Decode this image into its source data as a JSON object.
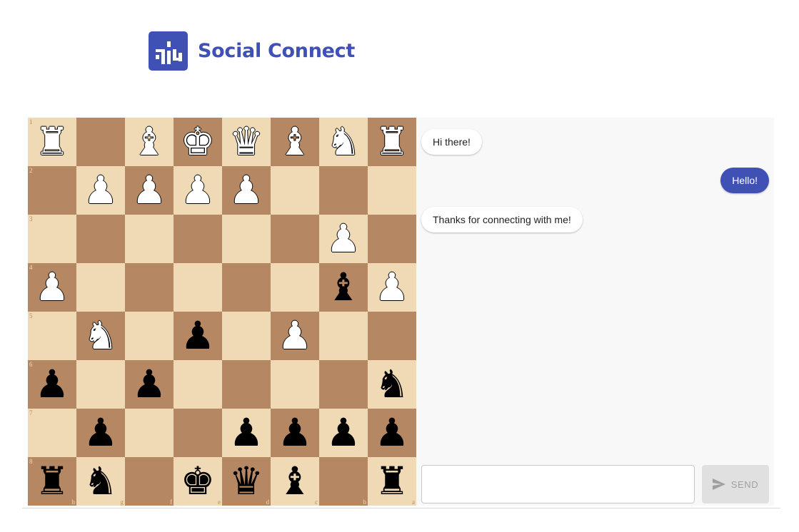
{
  "app": {
    "title": "Social Connect",
    "brand_color": "#3f51b5"
  },
  "board": {
    "light_color": "#f0d9b5",
    "dark_color": "#b58863",
    "rank_labels": [
      "1",
      "2",
      "3",
      "4",
      "5",
      "6",
      "7",
      "8"
    ],
    "file_labels": [
      "h",
      "g",
      "f",
      "e",
      "d",
      "c",
      "b",
      "a"
    ],
    "rows": [
      [
        "wR",
        "",
        "wB",
        "wK",
        "wQ",
        "wB",
        "wN",
        "wR"
      ],
      [
        "",
        "wP",
        "wP",
        "wP",
        "wP",
        "",
        "",
        ""
      ],
      [
        "",
        "",
        "",
        "",
        "",
        "",
        "wP",
        ""
      ],
      [
        "wP",
        "",
        "",
        "",
        "",
        "",
        "bB",
        "wP"
      ],
      [
        "",
        "wN",
        "",
        "bP",
        "",
        "wP",
        "",
        ""
      ],
      [
        "bP",
        "",
        "bP",
        "",
        "",
        "",
        "",
        "bN"
      ],
      [
        "",
        "bP",
        "",
        "",
        "bP",
        "bP",
        "bP",
        "bP"
      ],
      [
        "bR",
        "bN",
        "",
        "bK",
        "bQ",
        "bB",
        "",
        "bR"
      ]
    ]
  },
  "chat": {
    "messages": [
      {
        "text": "Hi there!",
        "from": "them"
      },
      {
        "text": "Hello!",
        "from": "me"
      },
      {
        "text": "Thanks for connecting with me!",
        "from": "them"
      }
    ],
    "input_value": "",
    "send_label": "SEND",
    "send_icon": "send-icon"
  }
}
